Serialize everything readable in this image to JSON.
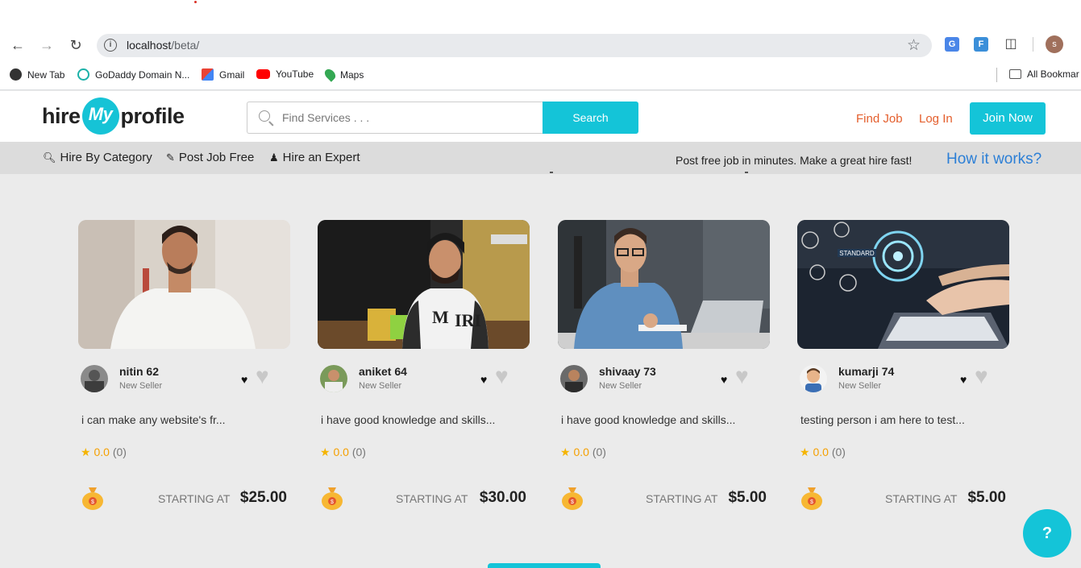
{
  "browser": {
    "url_host": "localhost",
    "url_path": "/beta/",
    "bookmarks": [
      "New Tab",
      "GoDaddy Domain N...",
      "Gmail",
      "YouTube",
      "Maps",
      "All Bookmar"
    ],
    "profile_initial": "s"
  },
  "header": {
    "logo_left": "hire",
    "logo_my": "My",
    "logo_right": "profile",
    "search_placeholder": "Find Services . . .",
    "search_button": "Search",
    "find_job": "Find Job",
    "log_in": "Log In",
    "join_now": "Join Now"
  },
  "subnav": {
    "hire_by_category": "Hire By Category",
    "post_job_free": "Post Job Free",
    "hire_an_expert": "Hire an Expert",
    "tagline": "Post free job in minutes. Make a great hire fast!",
    "how_it_works": "How it works?"
  },
  "cards": [
    {
      "name": "nitin 62",
      "level": "New Seller",
      "desc": "i can make any website's fr...",
      "rating": "0.0",
      "reviews": "(0)",
      "starting_label": "STARTING AT",
      "price": "$25.00"
    },
    {
      "name": "aniket 64",
      "level": "New Seller",
      "desc": "i have good knowledge and skills...",
      "rating": "0.0",
      "reviews": "(0)",
      "starting_label": "STARTING AT",
      "price": "$30.00"
    },
    {
      "name": "shivaay 73",
      "level": "New Seller",
      "desc": "i have good knowledge and skills...",
      "rating": "0.0",
      "reviews": "(0)",
      "starting_label": "STARTING AT",
      "price": "$5.00"
    },
    {
      "name": "kumarji 74",
      "level": "New Seller",
      "desc": "testing person i am here to test...",
      "rating": "0.0",
      "reviews": "(0)",
      "starting_label": "STARTING AT",
      "price": "$5.00"
    }
  ],
  "help_button": "?",
  "colors": {
    "accent": "#14c4d8",
    "link_orange": "#e45e2c",
    "link_blue": "#2c7fd6",
    "star": "#f5b400"
  }
}
